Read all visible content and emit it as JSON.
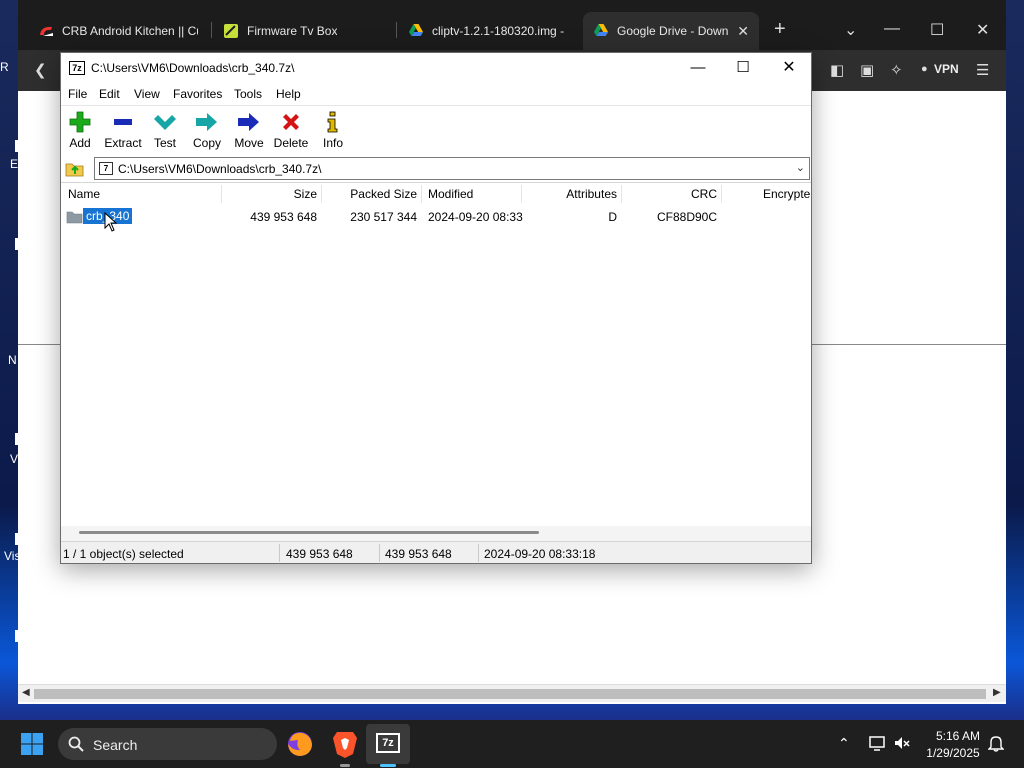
{
  "browser": {
    "tabs": [
      {
        "title": "CRB Android Kitchen || Cu",
        "icon": "crb-logo-icon"
      },
      {
        "title": "Firmware Tv Box",
        "icon": "firmware-logo-icon"
      },
      {
        "title": "cliptv-1.2.1-180320.img -",
        "icon": "google-drive-icon"
      },
      {
        "title": "Google Drive - Down",
        "icon": "google-drive-icon",
        "active": true
      }
    ],
    "vpn_label": "VPN"
  },
  "desktop": {
    "labels": [
      "R",
      "E",
      "N",
      "V",
      "Vis"
    ]
  },
  "zip_window": {
    "title": "C:\\Users\\VM6\\Downloads\\crb_340.7z\\",
    "app_icon_text": "7z",
    "menu": [
      "File",
      "Edit",
      "View",
      "Favorites",
      "Tools",
      "Help"
    ],
    "toolbar": {
      "add": "Add",
      "extract": "Extract",
      "test": "Test",
      "copy": "Copy",
      "move": "Move",
      "delete": "Delete",
      "info": "Info"
    },
    "address": "C:\\Users\\VM6\\Downloads\\crb_340.7z\\",
    "columns": {
      "name": "Name",
      "size": "Size",
      "packed_size": "Packed Size",
      "modified": "Modified",
      "attributes": "Attributes",
      "crc": "CRC",
      "encrypted": "Encrypte"
    },
    "rows": [
      {
        "name": "crb_340",
        "size": "439 953 648",
        "packed_size": "230 517 344",
        "modified": "2024-09-20 08:33",
        "attributes": "D",
        "crc": "CF88D90C"
      }
    ],
    "status": {
      "selection": "1 / 1 object(s) selected",
      "size": "439 953 648",
      "packed": "439 953 648",
      "modified": "2024-09-20 08:33:18"
    }
  },
  "taskbar": {
    "search_label": "Search",
    "apps": [
      "firefox-icon",
      "brave-icon",
      "7zip-icon"
    ],
    "active_app_text": "7z",
    "time": "5:16 AM",
    "date": "1/29/2025"
  },
  "colors": {
    "selection": "#1874d2",
    "add_green": "#1aaa1a",
    "extract_blue": "#1a2bb8",
    "test_teal": "#17a5a5",
    "delete_red": "#d41414",
    "taskbar": "#1f1f1f"
  }
}
